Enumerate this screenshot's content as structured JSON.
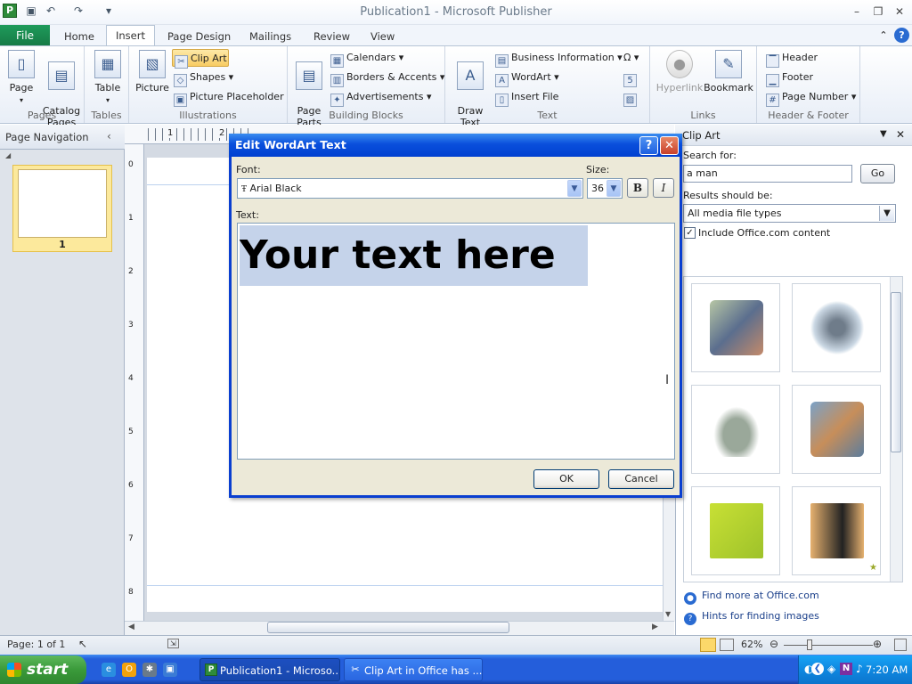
{
  "titlebar": {
    "app_icon": "P",
    "title": "Publication1  -  Microsoft Publisher"
  },
  "tabs": [
    {
      "label": "File"
    },
    {
      "label": "Home"
    },
    {
      "label": "Insert"
    },
    {
      "label": "Page Design"
    },
    {
      "label": "Mailings"
    },
    {
      "label": "Review"
    },
    {
      "label": "View"
    }
  ],
  "ribbon": {
    "groups": {
      "pages": "Pages",
      "tables": "Tables",
      "illustrations": "Illustrations",
      "building_blocks": "Building Blocks",
      "text": "Text",
      "links": "Links",
      "header_footer": "Header & Footer"
    },
    "page": "Page",
    "catalog_pages": "Catalog\nPages",
    "table": "Table",
    "picture": "Picture",
    "clip_art": "Clip Art",
    "shapes": "Shapes",
    "picture_placeholder": "Picture Placeholder",
    "page_parts": "Page\nParts",
    "calendars": "Calendars",
    "borders_accents": "Borders & Accents",
    "advertisements": "Advertisements",
    "draw_text_box": "Draw\nText Box",
    "business_information": "Business Information",
    "wordart": "WordArt",
    "insert_file": "Insert File",
    "hyperlink": "Hyperlink",
    "bookmark": "Bookmark",
    "header": "Header",
    "footer": "Footer",
    "page_number": "Page Number"
  },
  "nav": {
    "title": "Page Navigation",
    "page_number": "1"
  },
  "ruler": {
    "h_marks": [
      "1",
      "2"
    ],
    "v_marks": [
      "0",
      "1",
      "2",
      "3",
      "4",
      "5",
      "6",
      "7",
      "8"
    ]
  },
  "clipart": {
    "title": "Clip Art",
    "search_label": "Search for:",
    "search_value": "a man",
    "go": "Go",
    "results_label": "Results should be:",
    "results_value": "All media file types",
    "include_label": "Include Office.com content",
    "find_more": "Find more at Office.com",
    "hints": "Hints for finding images",
    "items": [
      "man-camera",
      "man-gears",
      "baseball-player",
      "business-meeting",
      "man-computer",
      "men-gear"
    ]
  },
  "dialog": {
    "title": "Edit WordArt Text",
    "font_label": "Font:",
    "font_value": "Arial Black",
    "size_label": "Size:",
    "size_value": "36",
    "bold": "B",
    "italic": "I",
    "text_label": "Text:",
    "text_value": "Your text here",
    "ok": "OK",
    "cancel": "Cancel"
  },
  "status": {
    "page": "Page: 1 of 1",
    "zoom": "62%"
  },
  "taskbar": {
    "start": "start",
    "tasks": [
      "Publication1 - Microso...",
      "Clip Art in Office has ..."
    ],
    "time": "7:20 AM"
  },
  "colors": {
    "accent": "#1f9b5b",
    "dialog_title": "#0a4fdc",
    "taskbar": "#245edb"
  }
}
